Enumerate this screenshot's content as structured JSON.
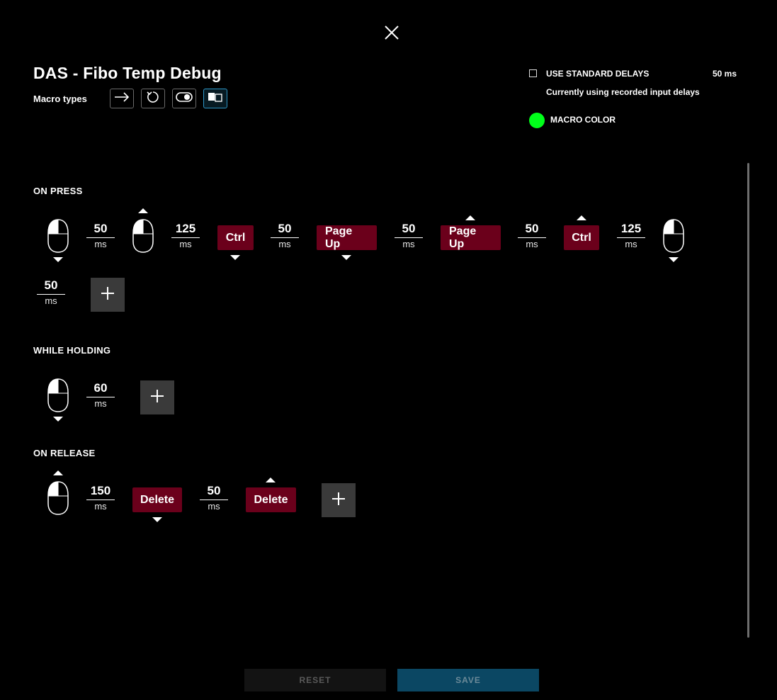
{
  "header": {
    "title": "DAS - Fibo Temp Debug",
    "macro_types_label": "Macro types",
    "macro_types": [
      {
        "icon": "arrow-right-icon"
      },
      {
        "icon": "repeat-icon"
      },
      {
        "icon": "toggle-icon"
      },
      {
        "icon": "sequence-icon",
        "active": true
      }
    ]
  },
  "settings": {
    "use_standard_delays_label": "USE STANDARD DELAYS",
    "standard_delay_value": "50 ms",
    "standard_delays_checked": false,
    "delay_note": "Currently using recorded input delays",
    "macro_color_label": "MACRO COLOR",
    "macro_color": "#00ff1a"
  },
  "sections": {
    "on_press": {
      "label": "ON PRESS",
      "steps": [
        {
          "type": "mouse",
          "direction": "down"
        },
        {
          "type": "delay",
          "value": "50",
          "unit": "ms"
        },
        {
          "type": "mouse",
          "direction": "up"
        },
        {
          "type": "delay",
          "value": "125",
          "unit": "ms"
        },
        {
          "type": "key",
          "label": "Ctrl",
          "direction": "down"
        },
        {
          "type": "delay",
          "value": "50",
          "unit": "ms"
        },
        {
          "type": "key",
          "label": "Page Up",
          "direction": "down"
        },
        {
          "type": "delay",
          "value": "50",
          "unit": "ms"
        },
        {
          "type": "key",
          "label": "Page Up",
          "direction": "up"
        },
        {
          "type": "delay",
          "value": "50",
          "unit": "ms"
        },
        {
          "type": "key",
          "label": "Ctrl",
          "direction": "up"
        },
        {
          "type": "delay",
          "value": "125",
          "unit": "ms"
        },
        {
          "type": "mouse",
          "direction": "down"
        },
        {
          "type": "delay",
          "value": "50",
          "unit": "ms"
        }
      ]
    },
    "while_holding": {
      "label": "WHILE HOLDING",
      "steps": [
        {
          "type": "mouse",
          "direction": "down"
        },
        {
          "type": "delay",
          "value": "60",
          "unit": "ms"
        }
      ]
    },
    "on_release": {
      "label": "ON RELEASE",
      "steps": [
        {
          "type": "mouse",
          "direction": "up"
        },
        {
          "type": "delay",
          "value": "150",
          "unit": "ms"
        },
        {
          "type": "key",
          "label": "Delete",
          "direction": "down"
        },
        {
          "type": "delay",
          "value": "50",
          "unit": "ms"
        },
        {
          "type": "key",
          "label": "Delete",
          "direction": "up"
        }
      ]
    }
  },
  "footer": {
    "reset_label": "RESET",
    "save_label": "SAVE"
  },
  "colors": {
    "key_bg": "#6b001b",
    "active_accent": "#2d97c8",
    "save_bg": "#0b4763"
  }
}
